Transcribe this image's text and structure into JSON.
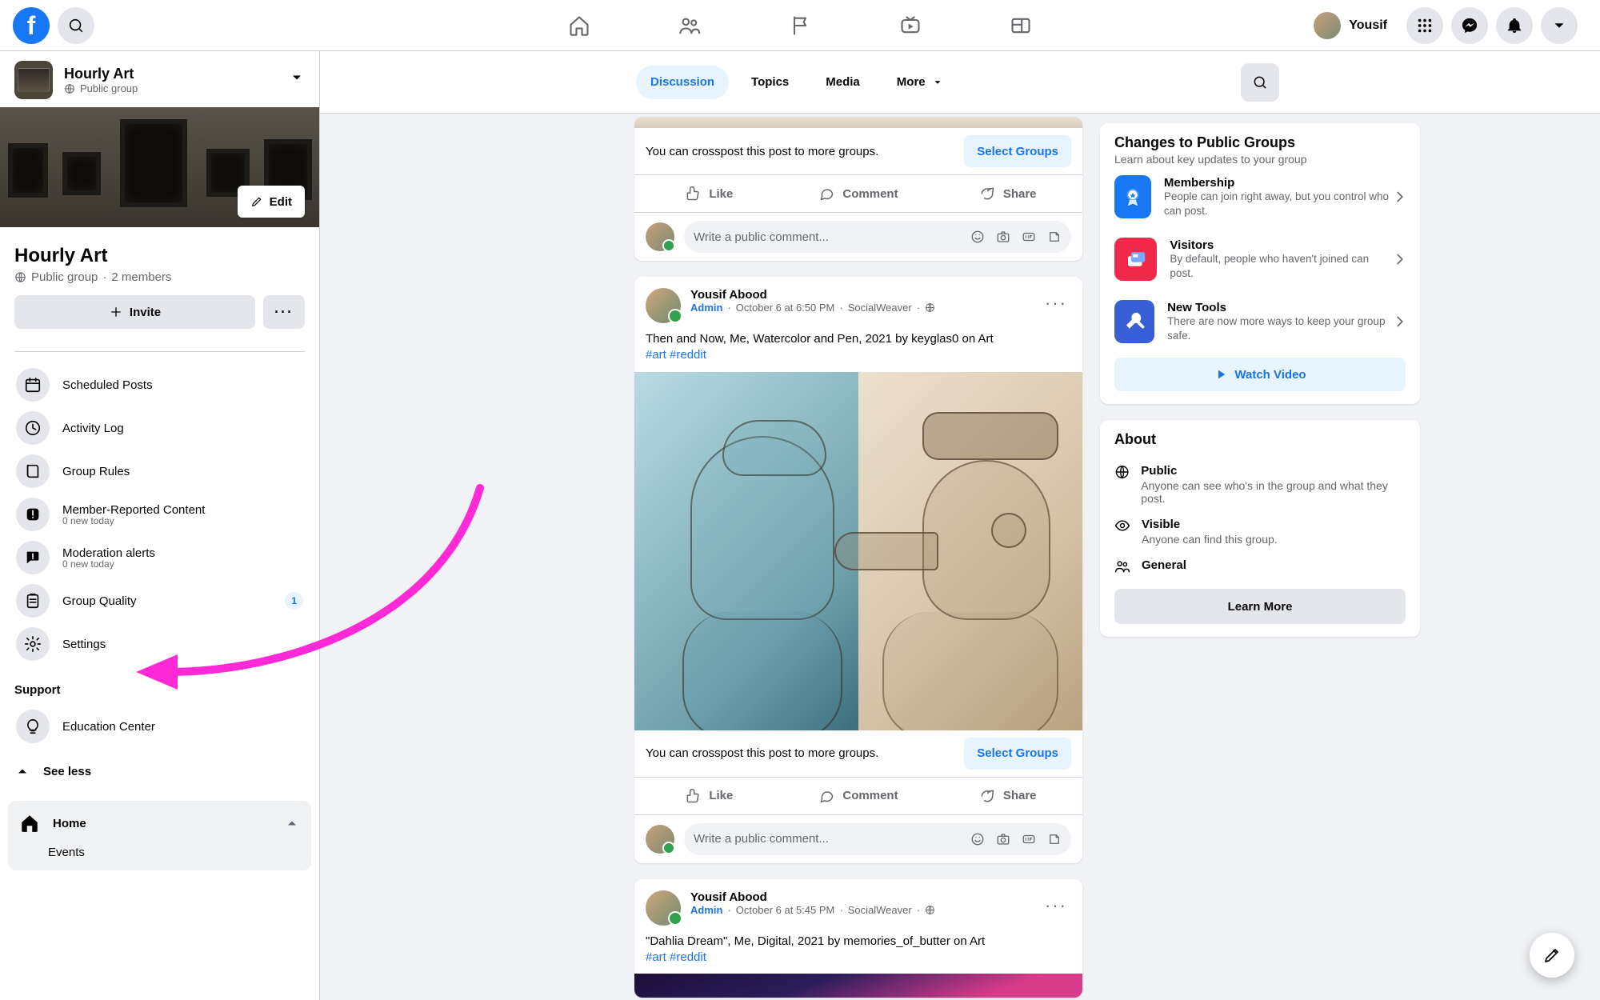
{
  "topnav": {
    "user_name": "Yousif"
  },
  "sidebar": {
    "header": {
      "title": "Hourly Art",
      "subtitle": "Public group"
    },
    "cover": {
      "edit_label": "Edit"
    },
    "title": "Hourly Art",
    "privacy": "Public group",
    "members": "2 members",
    "invite_label": "Invite",
    "items": [
      {
        "label": "Scheduled Posts"
      },
      {
        "label": "Activity Log"
      },
      {
        "label": "Group Rules"
      },
      {
        "label": "Member-Reported Content",
        "sub": "0 new today"
      },
      {
        "label": "Moderation alerts",
        "sub": "0 new today"
      },
      {
        "label": "Group Quality",
        "badge": "1"
      },
      {
        "label": "Settings"
      }
    ],
    "support_header": "Support",
    "education": "Education Center",
    "see_less": "See less",
    "home": "Home",
    "events": "Events"
  },
  "tabs": {
    "items": [
      {
        "label": "Discussion",
        "active": true
      },
      {
        "label": "Topics"
      },
      {
        "label": "Media"
      }
    ],
    "more": "More"
  },
  "feed": {
    "crosspost_text": "You can crosspost this post to more groups.",
    "select_groups": "Select Groups",
    "like": "Like",
    "comment": "Comment",
    "share": "Share",
    "comment_placeholder": "Write a public comment...",
    "posts": [
      {
        "author": "Yousif Abood",
        "role": "Admin",
        "time": "October 6 at 6:50 PM",
        "via": "SocialWeaver",
        "text": "Then and Now, Me, Watercolor and Pen, 2021 by keyglas0 on Art",
        "tag1": "#art",
        "tag2": "#reddit"
      },
      {
        "author": "Yousif Abood",
        "role": "Admin",
        "time": "October 6 at 5:45 PM",
        "via": "SocialWeaver",
        "text": "\"Dahlia Dream\", Me, Digital, 2021 by memories_of_butter on Art",
        "tag1": "#art",
        "tag2": "#reddit"
      }
    ]
  },
  "changes_card": {
    "title": "Changes to Public Groups",
    "subtitle": "Learn about key updates to your group",
    "items": [
      {
        "title": "Membership",
        "desc": "People can join right away, but you control who can post.",
        "color": "#1877f2"
      },
      {
        "title": "Visitors",
        "desc": "By default, people who haven't joined can post.",
        "color": "#f02849"
      },
      {
        "title": "New Tools",
        "desc": "There are now more ways to keep your group safe.",
        "color": "#395fd6"
      }
    ],
    "watch": "Watch Video"
  },
  "about_card": {
    "title": "About",
    "rows": [
      {
        "title": "Public",
        "desc": "Anyone can see who's in the group and what they post."
      },
      {
        "title": "Visible",
        "desc": "Anyone can find this group."
      },
      {
        "title": "General"
      }
    ],
    "learn_more": "Learn More"
  }
}
